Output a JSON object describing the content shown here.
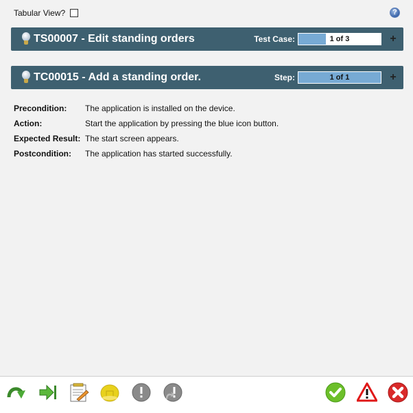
{
  "top": {
    "tabular_view_label": "Tabular View?",
    "tabular_view_checked": false,
    "help_glyph": "?"
  },
  "test_suite": {
    "icon": "lightbulb-icon",
    "title": "TS00007 - Edit standing orders",
    "progress_label": "Test Case:",
    "progress_text": "1 of 3",
    "progress_fraction": 0.333,
    "expand_glyph": "+"
  },
  "test_case": {
    "icon": "lightbulb-icon",
    "title": "TC00015 - Add a standing order.",
    "progress_label": "Step:",
    "progress_text": "1 of 1",
    "progress_fraction": 1.0,
    "expand_glyph": "+"
  },
  "details": [
    {
      "key": "Precondition:",
      "value": "The application is installed on the device."
    },
    {
      "key": "Action:",
      "value": "Start the application by pressing the blue icon button."
    },
    {
      "key": "Expected Result:",
      "value": "The start screen appears."
    },
    {
      "key": "Postcondition:",
      "value": "The application has started successfully."
    }
  ],
  "toolbar": {
    "left": [
      "redo-arrow-icon",
      "skip-to-end-icon",
      "notepad-edit-icon",
      "hard-hat-icon",
      "exclamation-gray-icon",
      "exclamation-forward-icon"
    ],
    "right": [
      "check-pass-icon",
      "warning-triangle-icon",
      "fail-x-icon"
    ]
  },
  "colors": {
    "panel_bg": "#3e6070",
    "progress_fill": "#77aad4",
    "page_bg": "#f2f2f2"
  }
}
